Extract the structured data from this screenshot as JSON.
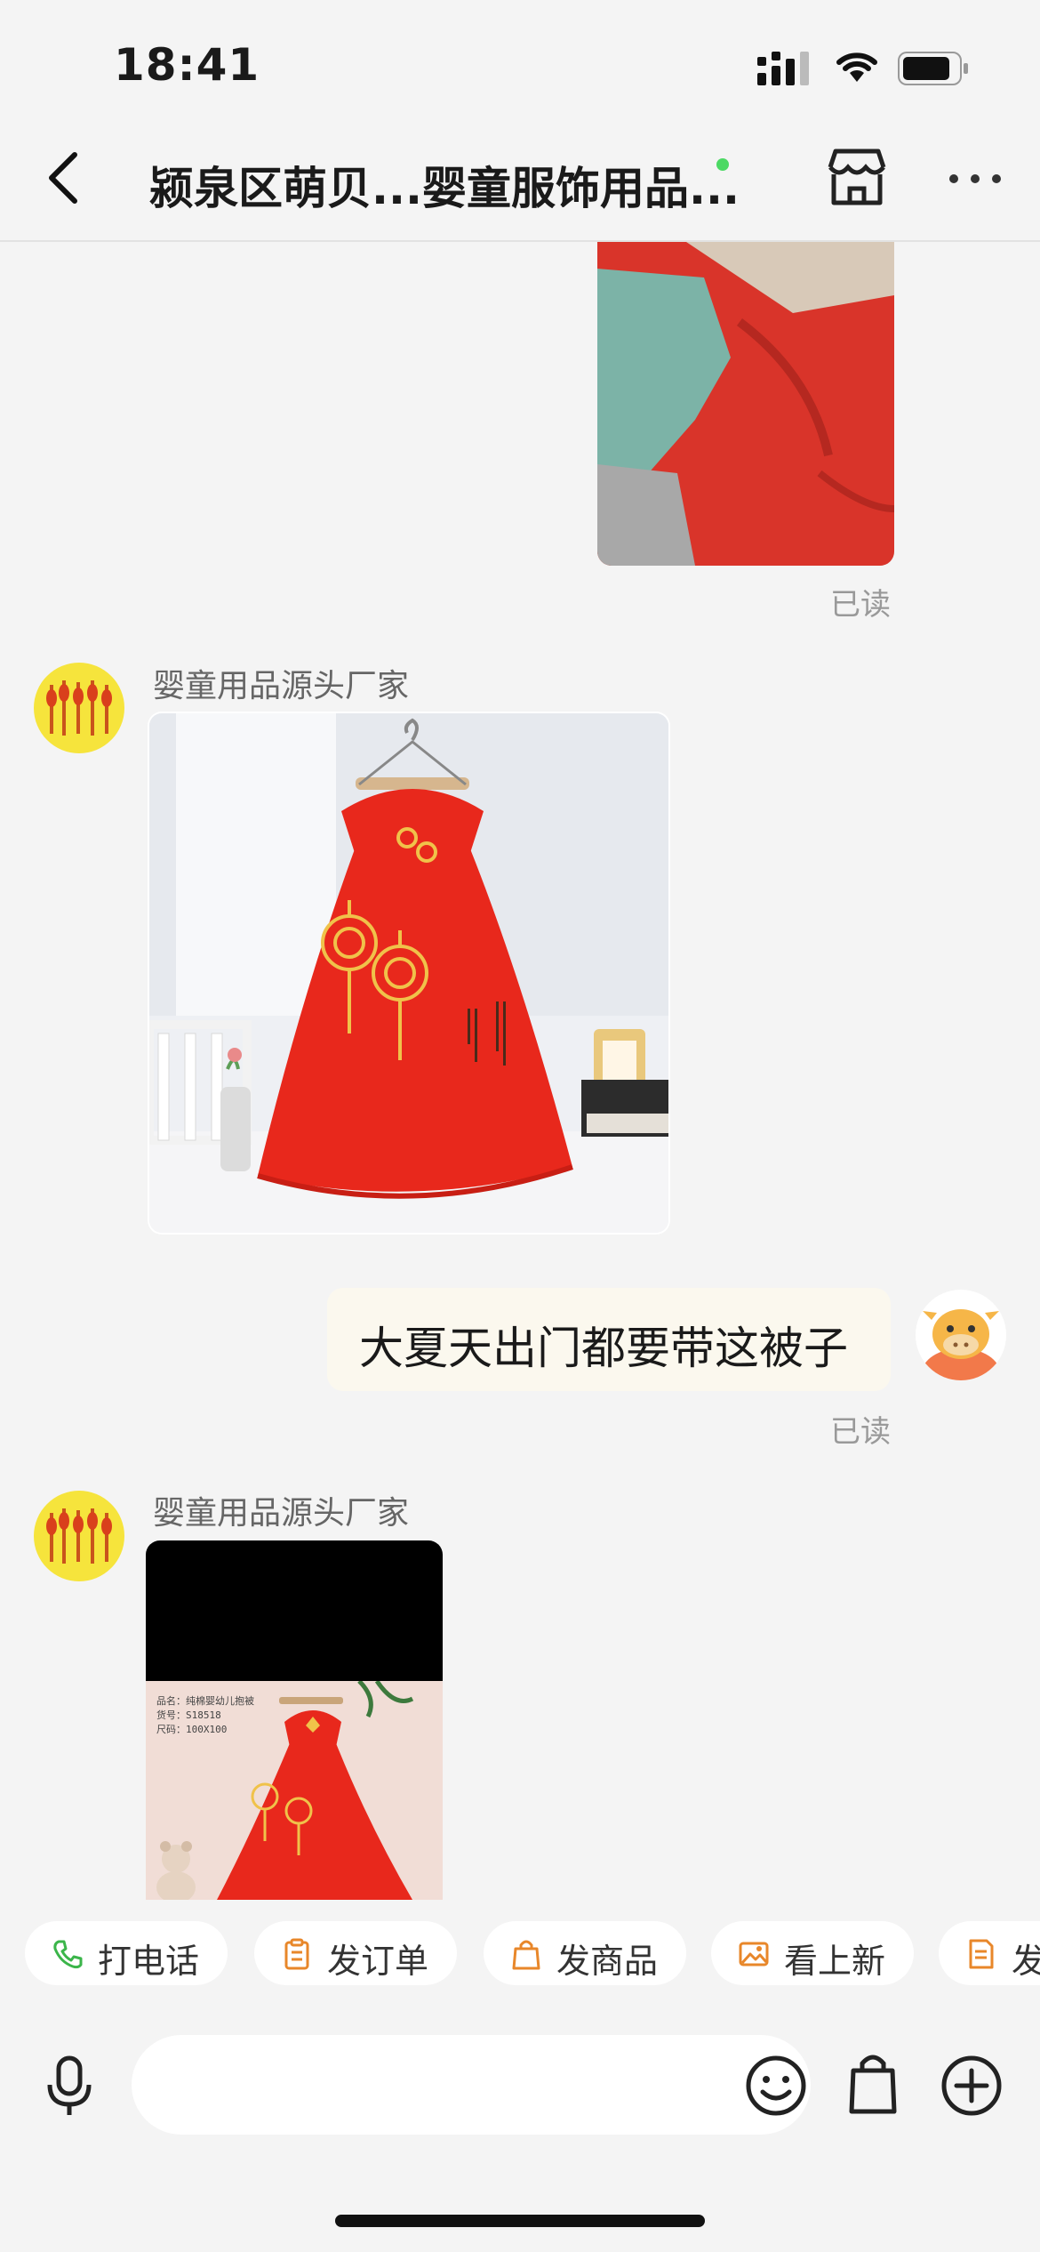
{
  "status_bar": {
    "time": "18:41"
  },
  "header": {
    "title": "颍泉区萌贝...婴童服饰用品..."
  },
  "messages": {
    "read_label_1": "已读",
    "sender_1": "婴童用品源头厂家",
    "outgoing_text": "大夏天出门都要带这被子",
    "read_label_2": "已读",
    "sender_2": "婴童用品源头厂家",
    "product_caption_line1": "品名：纯棉婴幼儿抱被",
    "product_caption_line2": "货号：S18518",
    "product_caption_line3": "尺码：100X100"
  },
  "quick_actions": [
    {
      "label": "打电话",
      "icon": "phone-icon"
    },
    {
      "label": "发订单",
      "icon": "clipboard-icon"
    },
    {
      "label": "发商品",
      "icon": "shopping-bag-icon"
    },
    {
      "label": "看上新",
      "icon": "image-icon"
    },
    {
      "label": "发",
      "icon": "document-icon"
    }
  ],
  "colors": {
    "accent_orange": "#e8872a",
    "call_green": "#3bb54a",
    "quilt_red": "#e8281c",
    "online_green": "#4cd964"
  }
}
